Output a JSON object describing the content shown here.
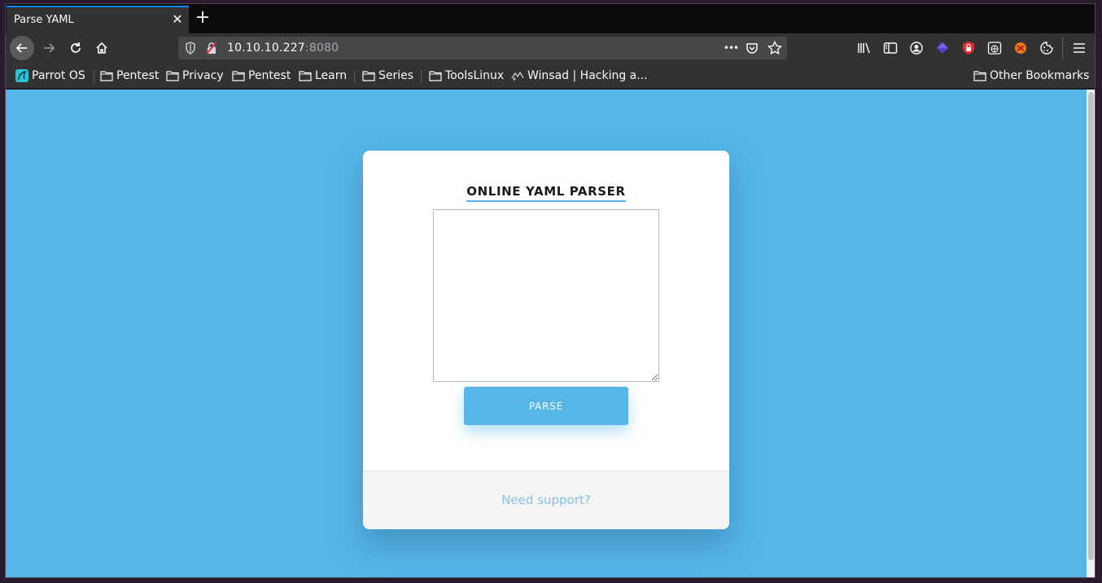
{
  "tab": {
    "title": "Parse YAML",
    "close": "✕",
    "new_tab": "+"
  },
  "urlbar": {
    "host": "10.10.10.227",
    "port": ":8080",
    "more": "•••"
  },
  "bookmarks": {
    "items": [
      "Parrot OS",
      "Pentest",
      "Privacy",
      "Pentest",
      "Learn",
      "Series",
      "ToolsLinux",
      "Winsad | Hacking a..."
    ],
    "other": "Other Bookmarks"
  },
  "page": {
    "heading": "ONLINE YAML PARSER",
    "textarea_value": "",
    "button_label": "PARSE",
    "support_link": "Need support?"
  },
  "colors": {
    "page_bg": "#56b6e8",
    "accent": "#56b6e8",
    "card_bg": "#ffffff",
    "footer_bg": "#f4f4f4"
  }
}
